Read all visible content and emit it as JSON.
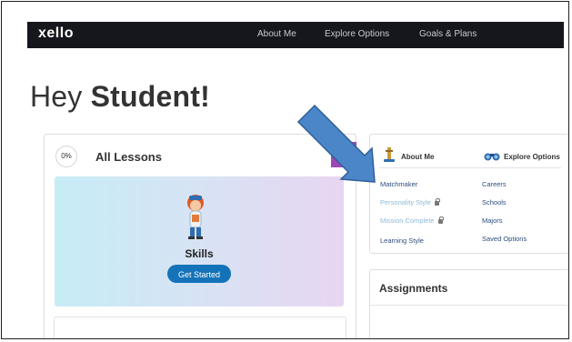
{
  "header": {
    "logo": "xello",
    "nav": [
      "About Me",
      "Explore Options",
      "Goals & Plans"
    ]
  },
  "greeting": {
    "prefix": "Hey ",
    "name": "Student!"
  },
  "lessons": {
    "progress": "0%",
    "title": "All Lessons",
    "featured": {
      "label": "Skills",
      "button": "Get Started"
    }
  },
  "about_card": {
    "about_heading": "About Me",
    "explore_heading": "Explore Options",
    "about_links": [
      {
        "label": "Matchmaker",
        "locked": false
      },
      {
        "label": "Personality Style",
        "locked": true
      },
      {
        "label": "Mission Complete",
        "locked": true
      },
      {
        "label": "Learning Style",
        "locked": false
      }
    ],
    "explore_links": [
      "Careers",
      "Schools",
      "Majors",
      "Saved Options"
    ]
  },
  "assignments": {
    "title": "Assignments"
  },
  "colors": {
    "topbar": "#16161d",
    "accent_blue": "#1473b8",
    "link": "#2b4d7e",
    "link_muted": "#8ebad8",
    "flag_purple": "#9e47b5",
    "annotation_arrow": "#4a86c8"
  },
  "icons": {
    "about": "tower-icon",
    "explore": "binoculars-icon",
    "lock": "lock-icon",
    "annotation": "arrow-pointer-icon"
  }
}
